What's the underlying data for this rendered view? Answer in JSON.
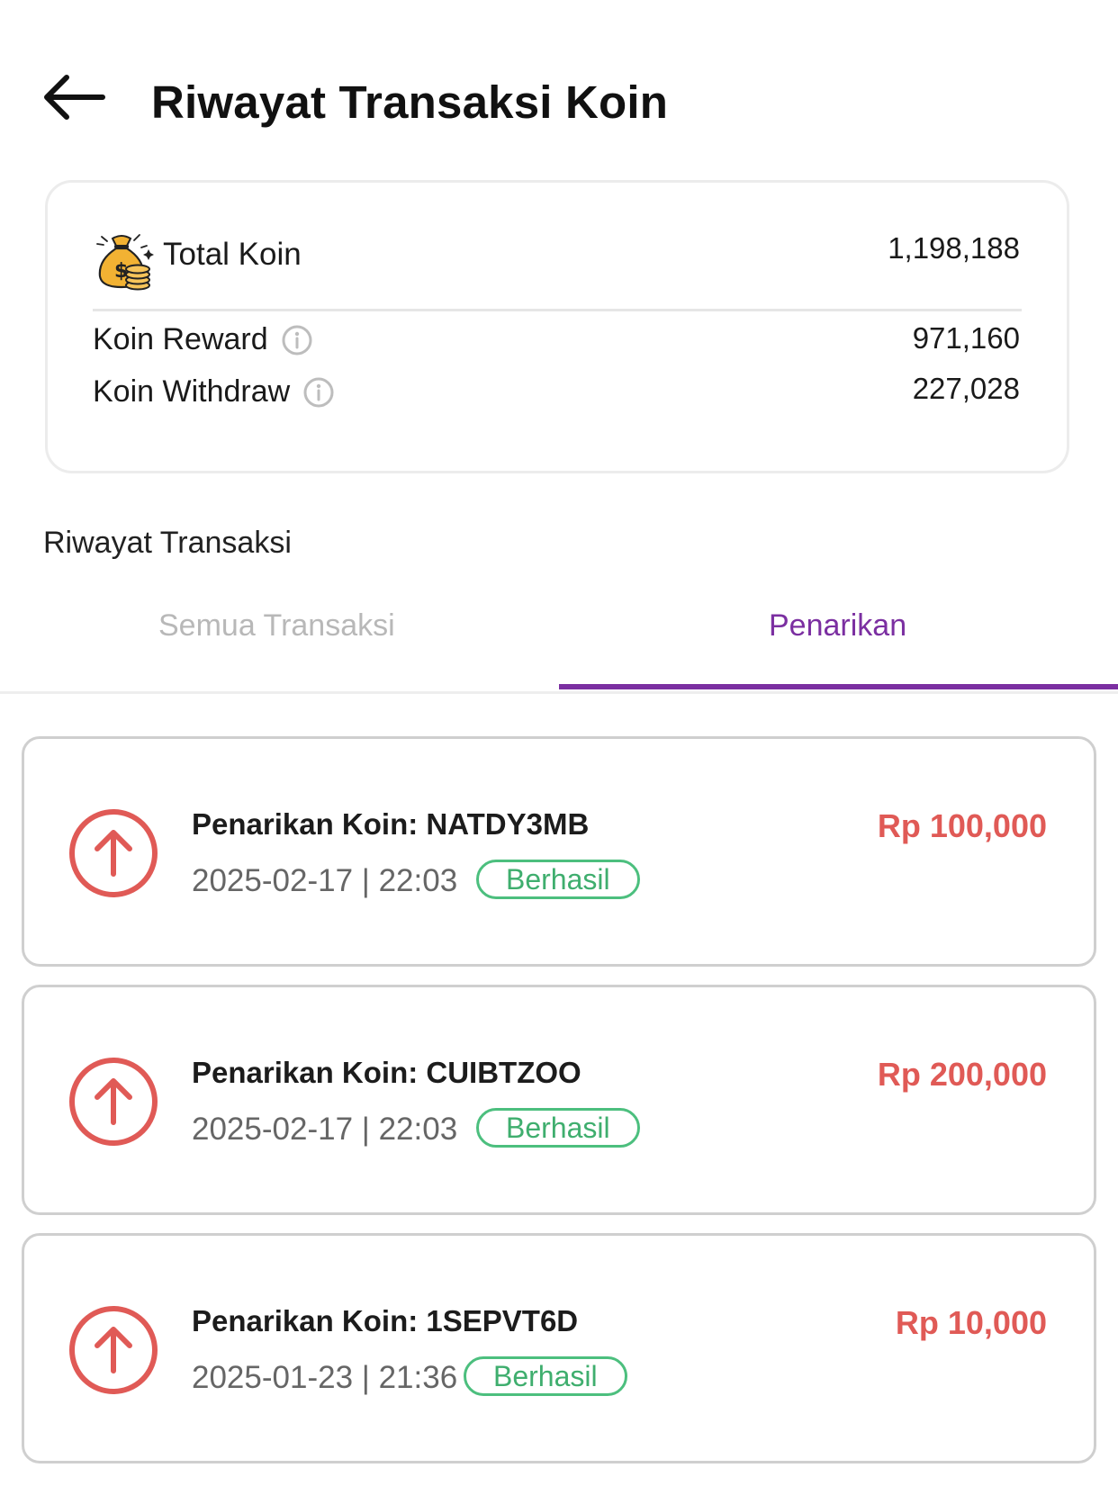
{
  "header": {
    "title": "Riwayat Transaksi Koin",
    "back_icon": "arrow-left-icon"
  },
  "summary": {
    "total_label": "Total Koin",
    "total_value": "1,198,188",
    "reward_label": "Koin Reward",
    "reward_value": "971,160",
    "withdraw_label": "Koin Withdraw",
    "withdraw_value": "227,028",
    "coin_icon": "money-bag-icon",
    "info_icon": "info-icon"
  },
  "history": {
    "section_title": "Riwayat Transaksi",
    "tabs": [
      {
        "label": "Semua Transaksi",
        "active": false
      },
      {
        "label": "Penarikan",
        "active": true
      }
    ],
    "items": [
      {
        "title": "Penarikan Koin: NATDY3MB",
        "datetime": "2025-02-17 | 22:03",
        "status": "Berhasil",
        "amount": "Rp 100,000"
      },
      {
        "title": "Penarikan Koin: CUIBTZOO",
        "datetime": "2025-02-17 | 22:03",
        "status": "Berhasil",
        "amount": "Rp 200,000"
      },
      {
        "title": "Penarikan Koin: 1SEPVT6D",
        "datetime": "2025-01-23 | 21:36",
        "status": "Berhasil",
        "amount": "Rp 10,000"
      }
    ]
  },
  "colors": {
    "accent": "#7b2fa1",
    "withdraw_red": "#e05a56",
    "success_green": "#3fae6e",
    "muted_text": "#b8b8b8"
  }
}
